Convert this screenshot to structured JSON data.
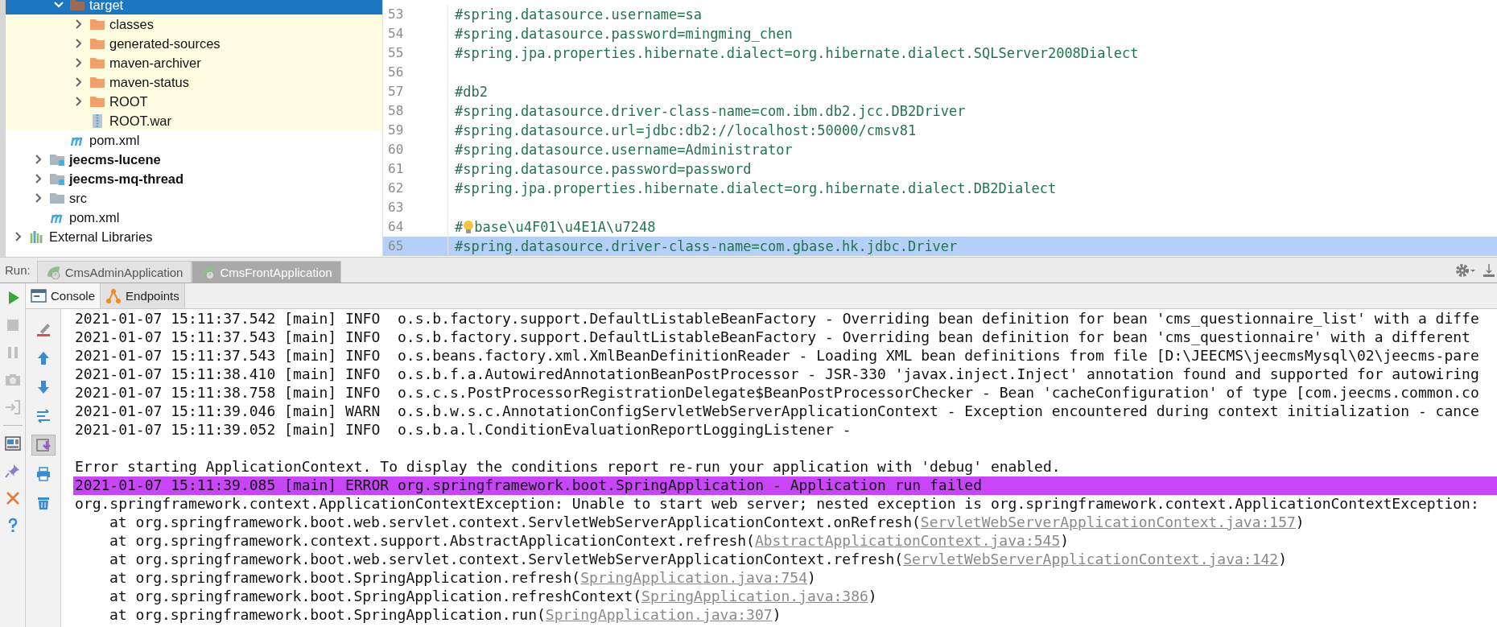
{
  "project_tree": {
    "items": [
      {
        "children": [
          {
            "children": [
              {
                "label": "target",
                "kind": "target",
                "expanded": true,
                "selected": true,
                "excluded": true,
                "children": [
                  {
                    "label": "classes",
                    "kind": "folder",
                    "expanded": false,
                    "selected": false
                  },
                  {
                    "label": "generated-sources",
                    "kind": "folder",
                    "expanded": false,
                    "selected": false
                  },
                  {
                    "label": "maven-archiver",
                    "kind": "folder",
                    "expanded": false,
                    "selected": false
                  },
                  {
                    "label": "maven-status",
                    "kind": "folder",
                    "expanded": false,
                    "selected": false
                  },
                  {
                    "label": "ROOT",
                    "kind": "folder",
                    "expanded": false,
                    "selected": false
                  },
                  {
                    "label": "ROOT.war",
                    "kind": "archive",
                    "selected": false
                  }
                ]
              },
              {
                "label": "pom.xml",
                "kind": "maven",
                "selected": false
              }
            ]
          },
          {
            "label": "jeecms-lucene",
            "kind": "module",
            "expanded": false,
            "selected": false
          },
          {
            "label": "jeecms-mq-thread",
            "kind": "module",
            "expanded": false,
            "selected": false
          },
          {
            "label": "src",
            "kind": "plain",
            "expanded": false,
            "selected": false
          },
          {
            "label": "pom.xml",
            "kind": "maven",
            "selected": false
          }
        ]
      },
      {
        "label": "External Libraries",
        "kind": "libraries",
        "expanded": false,
        "selected": false
      }
    ]
  },
  "editor": {
    "lines": [
      {
        "number": "53",
        "text": "#spring.datasource.username=sa",
        "current": false
      },
      {
        "number": "54",
        "text": "#spring.datasource.password=mingming_chen",
        "current": false
      },
      {
        "number": "55",
        "text": "#spring.jpa.properties.hibernate.dialect=org.hibernate.dialect.SQLServer2008Dialect",
        "current": false
      },
      {
        "number": "56",
        "current": false
      },
      {
        "number": "57",
        "text": "#db2",
        "current": false
      },
      {
        "number": "58",
        "text": "#spring.datasource.driver-class-name=com.ibm.db2.jcc.DB2Driver",
        "current": false
      },
      {
        "number": "59",
        "text": "#spring.datasource.url=jdbc:db2://localhost:50000/cmsv81",
        "current": false
      },
      {
        "number": "60",
        "text": "#spring.datasource.username=Administrator",
        "current": false
      },
      {
        "number": "61",
        "text": "#spring.datasource.password=password",
        "current": false
      },
      {
        "number": "62",
        "text": "#spring.jpa.properties.hibernate.dialect=org.hibernate.dialect.DB2Dialect",
        "current": false
      },
      {
        "number": "63",
        "current": false
      },
      {
        "number": "64",
        "text": "#",
        "bulb": true,
        "text_after": "base\\u4F01\\u4E1A\\u7248",
        "current": false
      },
      {
        "number": "65",
        "text": "#spring.datasource.driver-class-name=com.gbase.hk.jdbc.Driver",
        "current": true
      }
    ]
  },
  "run_panel": {
    "label": "Run:",
    "tabs": [
      {
        "label": "CmsAdminApplication",
        "selected": false
      },
      {
        "label": "CmsFrontApplication",
        "selected": true
      }
    ],
    "side_tools": [
      {
        "kind": "run",
        "disabled": false
      },
      {
        "kind": "stop",
        "disabled": true
      },
      {
        "kind": "pause",
        "disabled": true
      },
      {
        "kind": "camera",
        "disabled": true
      },
      {
        "kind": "exit",
        "disabled": true
      },
      {
        "kind": "layout",
        "disabled": false
      },
      {
        "kind": "pin",
        "disabled": false
      },
      {
        "kind": "close",
        "disabled": false
      },
      {
        "kind": "help",
        "disabled": false
      }
    ],
    "sub_tabs": [
      {
        "label": "Console",
        "kind": "console",
        "selected": true
      },
      {
        "label": "Endpoints",
        "kind": "endpoints",
        "selected": false
      }
    ],
    "console_tools": [
      {
        "kind": "clear",
        "on": false
      },
      {
        "kind": "up",
        "on": false
      },
      {
        "kind": "down",
        "on": false
      },
      {
        "kind": "wrap",
        "on": false
      },
      {
        "kind": "scroll-end",
        "on": true
      },
      {
        "kind": "print",
        "on": false
      },
      {
        "kind": "trash",
        "on": false
      }
    ],
    "console": [
      {
        "kind": "log",
        "text": "2021-01-07 15:11:37.542 [main] INFO  o.s.b.factory.support.DefaultListableBeanFactory - Overriding bean definition for bean 'cms_questionnaire_list' with a diffe"
      },
      {
        "kind": "log",
        "text": "2021-01-07 15:11:37.543 [main] INFO  o.s.b.factory.support.DefaultListableBeanFactory - Overriding bean definition for bean 'cms_questionnaire' with a different"
      },
      {
        "kind": "log",
        "text": "2021-01-07 15:11:37.543 [main] INFO  o.s.beans.factory.xml.XmlBeanDefinitionReader - Loading XML bean definitions from file [D:\\JEECMS\\jeecmsMysql\\02\\jeecms-pare"
      },
      {
        "kind": "log",
        "text": "2021-01-07 15:11:38.410 [main] INFO  o.s.b.f.a.AutowiredAnnotationBeanPostProcessor - JSR-330 'javax.inject.Inject' annotation found and supported for autowiring"
      },
      {
        "kind": "log",
        "text": "2021-01-07 15:11:38.758 [main] INFO  o.s.c.s.PostProcessorRegistrationDelegate$BeanPostProcessorChecker - Bean 'cacheConfiguration' of type [com.jeecms.common.co"
      },
      {
        "kind": "log",
        "text": "2021-01-07 15:11:39.046 [main] WARN  o.s.b.w.s.c.AnnotationConfigServletWebServerApplicationContext - Exception encountered during context initialization - cance"
      },
      {
        "kind": "log",
        "text": "2021-01-07 15:11:39.052 [main] INFO  o.s.b.a.l.ConditionEvaluationReportLoggingListener -"
      },
      {
        "kind": "blank"
      },
      {
        "kind": "log",
        "text": "Error starting ApplicationContext. To display the conditions report re-run your application with 'debug' enabled."
      },
      {
        "kind": "error",
        "text": "2021-01-07 15:11:39.085 [main] ERROR org.springframework.boot.SpringApplication - Application run failed"
      },
      {
        "kind": "log",
        "text": "org.springframework.context.ApplicationContextException: Unable to start web server; nested exception is org.springframework.context.ApplicationContextException:"
      },
      {
        "kind": "trace",
        "text": "at org.springframework.boot.web.servlet.context.ServletWebServerApplicationContext.onRefresh(",
        "link": "ServletWebServerApplicationContext.java:157",
        "tail": ")"
      },
      {
        "kind": "trace",
        "text": "at org.springframework.context.support.AbstractApplicationContext.refresh(",
        "link": "AbstractApplicationContext.java:545",
        "tail": ")"
      },
      {
        "kind": "trace",
        "text": "at org.springframework.boot.web.servlet.context.ServletWebServerApplicationContext.refresh(",
        "link": "ServletWebServerApplicationContext.java:142",
        "tail": ")"
      },
      {
        "kind": "trace",
        "text": "at org.springframework.boot.SpringApplication.refresh(",
        "link": "SpringApplication.java:754",
        "tail": ")"
      },
      {
        "kind": "trace",
        "text": "at org.springframework.boot.SpringApplication.refreshContext(",
        "link": "SpringApplication.java:386",
        "tail": ")"
      },
      {
        "kind": "trace",
        "text": "at org.springframework.boot.SpringApplication.run(",
        "link": "SpringApplication.java:307",
        "tail": ")"
      }
    ]
  }
}
